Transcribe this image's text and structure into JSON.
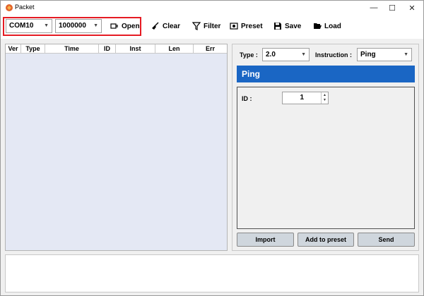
{
  "window": {
    "title": "Packet",
    "controls": {
      "minimize": "—",
      "maximize": "☐",
      "close": "✕"
    }
  },
  "toolbar": {
    "port": "COM10",
    "baudrate": "1000000",
    "open_label": "Open",
    "clear_label": "Clear",
    "filter_label": "Filter",
    "preset_label": "Preset",
    "save_label": "Save",
    "load_label": "Load"
  },
  "packet_table": {
    "columns": [
      "Ver",
      "Type",
      "Time",
      "ID",
      "Inst",
      "Len",
      "Err"
    ]
  },
  "side_panel": {
    "type_label": "Type :",
    "type_value": "2.0",
    "instruction_label": "Instruction :",
    "instruction_value": "Ping",
    "banner": "Ping",
    "id_label": "ID :",
    "id_value": "1",
    "import_label": "Import",
    "add_preset_label": "Add to preset",
    "send_label": "Send"
  },
  "colors": {
    "highlight": "#e51b23",
    "banner": "#1a66c4",
    "packet_bg": "#e4e8f4",
    "button_bg": "#cfd6dd"
  }
}
